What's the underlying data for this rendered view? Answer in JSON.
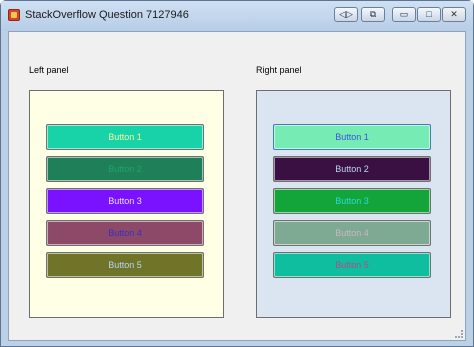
{
  "window": {
    "title": "StackOverflow Question 7127946",
    "controls": {
      "back_glyph": "◁▷",
      "pin_glyph": "⧉",
      "minimize_glyph": "▭",
      "maximize_glyph": "□",
      "close_glyph": "✕"
    }
  },
  "left_panel": {
    "label": "Left panel",
    "background": "#ffffe6",
    "buttons": [
      {
        "label": "Button 1",
        "bg": "#19d3a8",
        "fg": "#f3f8a8"
      },
      {
        "label": "Button 2",
        "bg": "#1e7f58",
        "fg": "#22a36a"
      },
      {
        "label": "Button 3",
        "bg": "#7a12ff",
        "fg": "#e8dcff"
      },
      {
        "label": "Button 4",
        "bg": "#8d4a68",
        "fg": "#3a2cc8"
      },
      {
        "label": "Button 5",
        "bg": "#707428",
        "fg": "#b8d4f0"
      }
    ]
  },
  "right_panel": {
    "label": "Right panel",
    "background": "#dbe5f1",
    "buttons": [
      {
        "label": "Button 1",
        "bg": "#76ebb3",
        "fg": "#3a55e0"
      },
      {
        "label": "Button 2",
        "bg": "#3a0f42",
        "fg": "#bcd6f2"
      },
      {
        "label": "Button 3",
        "bg": "#14a53a",
        "fg": "#2ad8e0"
      },
      {
        "label": "Button 4",
        "bg": "#7ea993",
        "fg": "#c9b8c0"
      },
      {
        "label": "Button 5",
        "bg": "#0fbe9e",
        "fg": "#b44a8a"
      }
    ]
  }
}
